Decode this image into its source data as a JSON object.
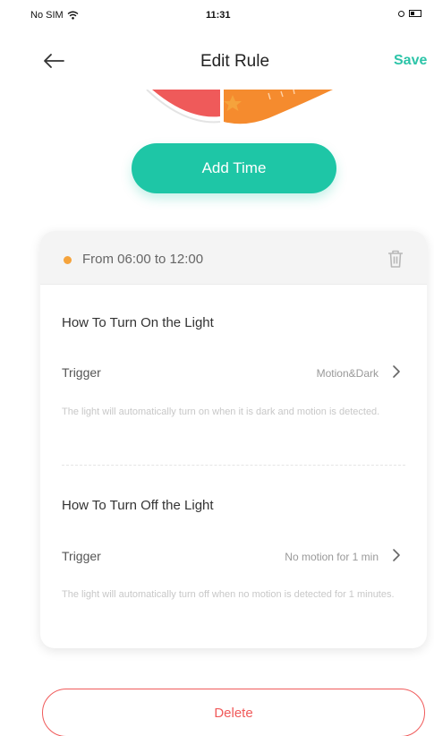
{
  "status_bar": {
    "carrier": "No SIM",
    "time": "11:31"
  },
  "header": {
    "title": "Edit Rule",
    "save_label": "Save"
  },
  "add_time_label": "Add Time",
  "rule": {
    "time_range": "From 06:00 to 12:00",
    "on_section": {
      "title": "How To Turn On the Light",
      "trigger_label": "Trigger",
      "trigger_value": "Motion&Dark",
      "description": "The light will automatically turn on when it is dark and motion is detected."
    },
    "off_section": {
      "title": "How To Turn Off the Light",
      "trigger_label": "Trigger",
      "trigger_value": "No motion for 1 min",
      "description": "The light will automatically turn off when no motion is detected for 1 minutes."
    }
  },
  "delete_label": "Delete",
  "colors": {
    "accent": "#1ec6a6",
    "danger": "#f05a5a",
    "dot": "#f5a33c"
  },
  "icons": {
    "back": "arrow-left-icon",
    "trash": "trash-icon",
    "chevron": "chevron-right-icon",
    "wifi": "wifi-icon"
  }
}
